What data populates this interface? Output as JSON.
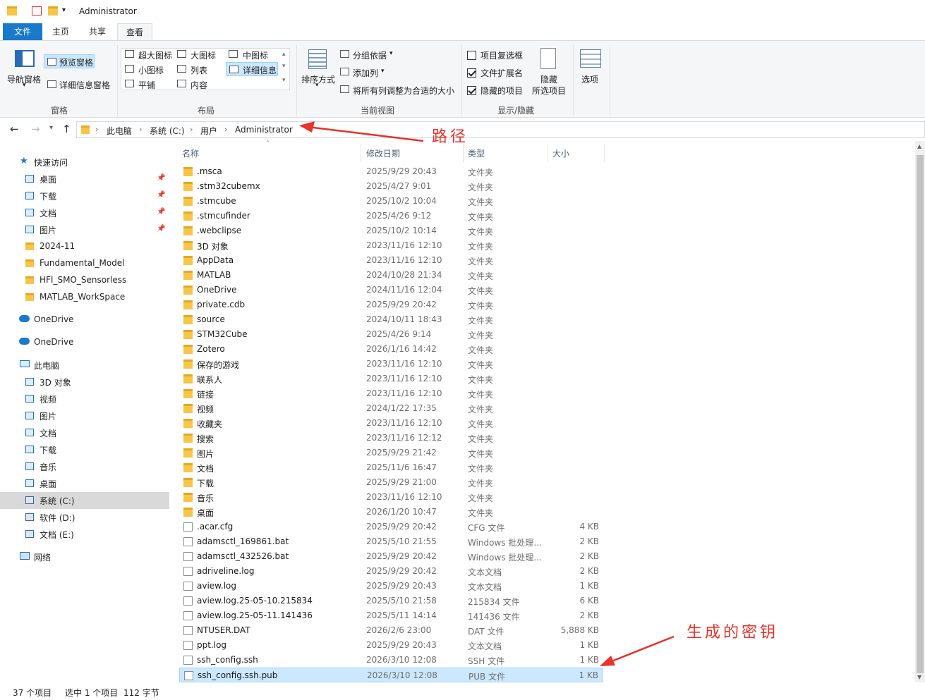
{
  "window": {
    "title": "Administrator"
  },
  "tabs": {
    "file": "文件",
    "home": "主页",
    "share": "共享",
    "view": "查看"
  },
  "ribbon": {
    "pane": {
      "nav_pane": "导航窗格",
      "preview_pane": "预览窗格",
      "details_pane": "详细信息窗格",
      "group": "窗格"
    },
    "layout": {
      "extra_large": "超大图标",
      "large": "大图标",
      "medium": "中图标",
      "small": "小图标",
      "list": "列表",
      "details": "详细信息",
      "tiles": "平铺",
      "content": "内容",
      "group": "布局"
    },
    "current_view": {
      "sort": "排序方式",
      "group_by": "分组依据",
      "add_col": "添加列",
      "fit_cols": "将所有列调整为合适的大小",
      "group": "当前视图"
    },
    "show_hide": {
      "item_checkbox": "项目复选框",
      "file_ext": "文件扩展名",
      "hidden_items": "隐藏的项目",
      "hide_line1": "隐藏",
      "hide_line2": "所选项目",
      "group": "显示/隐藏"
    },
    "options": "选项"
  },
  "address": {
    "crumbs": [
      "此电脑",
      "系统 (C:)",
      "用户",
      "Administrator"
    ]
  },
  "sidebar": {
    "quick_access": "快速访问",
    "quick_items": [
      "桌面",
      "下载",
      "文档",
      "图片",
      "2024-11",
      "Fundamental_Model",
      "HFI_SMO_Sensorless",
      "MATLAB_WorkSpace"
    ],
    "onedrive1": "OneDrive",
    "onedrive2": "OneDrive",
    "this_pc": "此电脑",
    "pc_items": [
      "3D 对象",
      "视频",
      "图片",
      "文档",
      "下载",
      "音乐",
      "桌面",
      "系统 (C:)",
      "软件 (D:)",
      "文档 (E:)"
    ],
    "network": "网络"
  },
  "columns": {
    "name": "名称",
    "date": "修改日期",
    "type": "类型",
    "size": "大小"
  },
  "files": [
    {
      "name": ".msca",
      "date": "2025/9/29 20:43",
      "type": "文件夹",
      "size": ""
    },
    {
      "name": ".stm32cubemx",
      "date": "2025/4/27 9:01",
      "type": "文件夹",
      "size": ""
    },
    {
      "name": ".stmcube",
      "date": "2025/10/2 10:04",
      "type": "文件夹",
      "size": ""
    },
    {
      "name": ".stmcufinder",
      "date": "2025/4/26 9:12",
      "type": "文件夹",
      "size": ""
    },
    {
      "name": ".webclipse",
      "date": "2025/10/2 10:14",
      "type": "文件夹",
      "size": ""
    },
    {
      "name": "3D 对象",
      "date": "2023/11/16 12:10",
      "type": "文件夹",
      "size": ""
    },
    {
      "name": "AppData",
      "date": "2023/11/16 12:10",
      "type": "文件夹",
      "size": ""
    },
    {
      "name": "MATLAB",
      "date": "2024/10/28 21:34",
      "type": "文件夹",
      "size": ""
    },
    {
      "name": "OneDrive",
      "date": "2024/11/16 12:04",
      "type": "文件夹",
      "size": ""
    },
    {
      "name": "private.cdb",
      "date": "2025/9/29 20:42",
      "type": "文件夹",
      "size": ""
    },
    {
      "name": "source",
      "date": "2024/10/11 18:43",
      "type": "文件夹",
      "size": ""
    },
    {
      "name": "STM32Cube",
      "date": "2025/4/26 9:14",
      "type": "文件夹",
      "size": ""
    },
    {
      "name": "Zotero",
      "date": "2026/1/16 14:42",
      "type": "文件夹",
      "size": ""
    },
    {
      "name": "保存的游戏",
      "date": "2023/11/16 12:10",
      "type": "文件夹",
      "size": ""
    },
    {
      "name": "联系人",
      "date": "2023/11/16 12:10",
      "type": "文件夹",
      "size": ""
    },
    {
      "name": "链接",
      "date": "2023/11/16 12:10",
      "type": "文件夹",
      "size": ""
    },
    {
      "name": "视频",
      "date": "2024/1/22 17:35",
      "type": "文件夹",
      "size": ""
    },
    {
      "name": "收藏夹",
      "date": "2023/11/16 12:10",
      "type": "文件夹",
      "size": ""
    },
    {
      "name": "搜索",
      "date": "2023/11/16 12:12",
      "type": "文件夹",
      "size": ""
    },
    {
      "name": "图片",
      "date": "2025/9/29 21:42",
      "type": "文件夹",
      "size": ""
    },
    {
      "name": "文档",
      "date": "2025/11/6 16:47",
      "type": "文件夹",
      "size": ""
    },
    {
      "name": "下载",
      "date": "2025/9/29 21:00",
      "type": "文件夹",
      "size": ""
    },
    {
      "name": "音乐",
      "date": "2023/11/16 12:10",
      "type": "文件夹",
      "size": ""
    },
    {
      "name": "桌面",
      "date": "2026/1/20 10:47",
      "type": "文件夹",
      "size": ""
    },
    {
      "name": ".acar.cfg",
      "date": "2025/9/29 20:42",
      "type": "CFG 文件",
      "size": "4 KB"
    },
    {
      "name": "adamsctl_169861.bat",
      "date": "2025/5/10 21:55",
      "type": "Windows 批处理...",
      "size": "2 KB"
    },
    {
      "name": "adamsctl_432526.bat",
      "date": "2025/9/29 20:42",
      "type": "Windows 批处理...",
      "size": "2 KB"
    },
    {
      "name": "adriveline.log",
      "date": "2025/9/29 20:42",
      "type": "文本文档",
      "size": "2 KB"
    },
    {
      "name": "aview.log",
      "date": "2025/9/29 20:43",
      "type": "文本文档",
      "size": "1 KB"
    },
    {
      "name": "aview.log.25-05-10.215834",
      "date": "2025/5/10 21:58",
      "type": "215834 文件",
      "size": "6 KB"
    },
    {
      "name": "aview.log.25-05-11.141436",
      "date": "2025/5/11 14:14",
      "type": "141436 文件",
      "size": "2 KB"
    },
    {
      "name": "NTUSER.DAT",
      "date": "2026/2/6 23:00",
      "type": "DAT 文件",
      "size": "5,888 KB"
    },
    {
      "name": "ppt.log",
      "date": "2025/9/29 20:43",
      "type": "文本文档",
      "size": "1 KB"
    },
    {
      "name": "ssh_config.ssh",
      "date": "2026/3/10 12:08",
      "type": "SSH 文件",
      "size": "1 KB"
    },
    {
      "name": "ssh_config.ssh.pub",
      "date": "2026/3/10 12:08",
      "type": "PUB 文件",
      "size": "1 KB"
    }
  ],
  "status": {
    "count": "37 个项目",
    "selected": "选中 1 个项目",
    "bytes": "112 字节"
  },
  "annotations": {
    "path": "路径",
    "key": "生成的密钥"
  },
  "colors": {
    "accent": "#1979ca",
    "selection": "#cce8ff",
    "annotation": "#e8322a",
    "folder": "#f6c648"
  }
}
